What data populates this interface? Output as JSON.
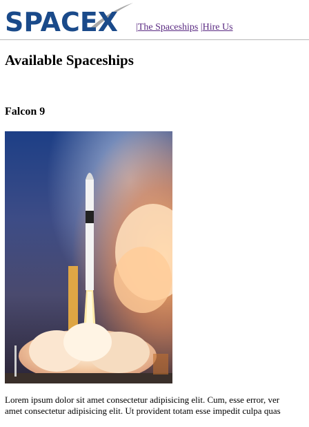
{
  "header": {
    "logo_text": "SPACEX",
    "nav": {
      "separator": "|",
      "spaceships_link": "The Spaceships",
      "hire_link": "Hire Us"
    },
    "colors": {
      "logo": "#1a4a8a",
      "swoosh": "#a8a8a8",
      "link": "#5a2a82"
    }
  },
  "main": {
    "title": "Available Spaceships",
    "ships": [
      {
        "name": "Falcon 9",
        "image_icon": "rocket-launch-photo",
        "description_lines": [
          "Lorem ipsum dolor sit amet consectetur adipisicing elit. Cum, esse error, ver",
          "amet consectetur adipisicing elit. Ut provident totam esse impedit culpa quas"
        ]
      }
    ]
  }
}
